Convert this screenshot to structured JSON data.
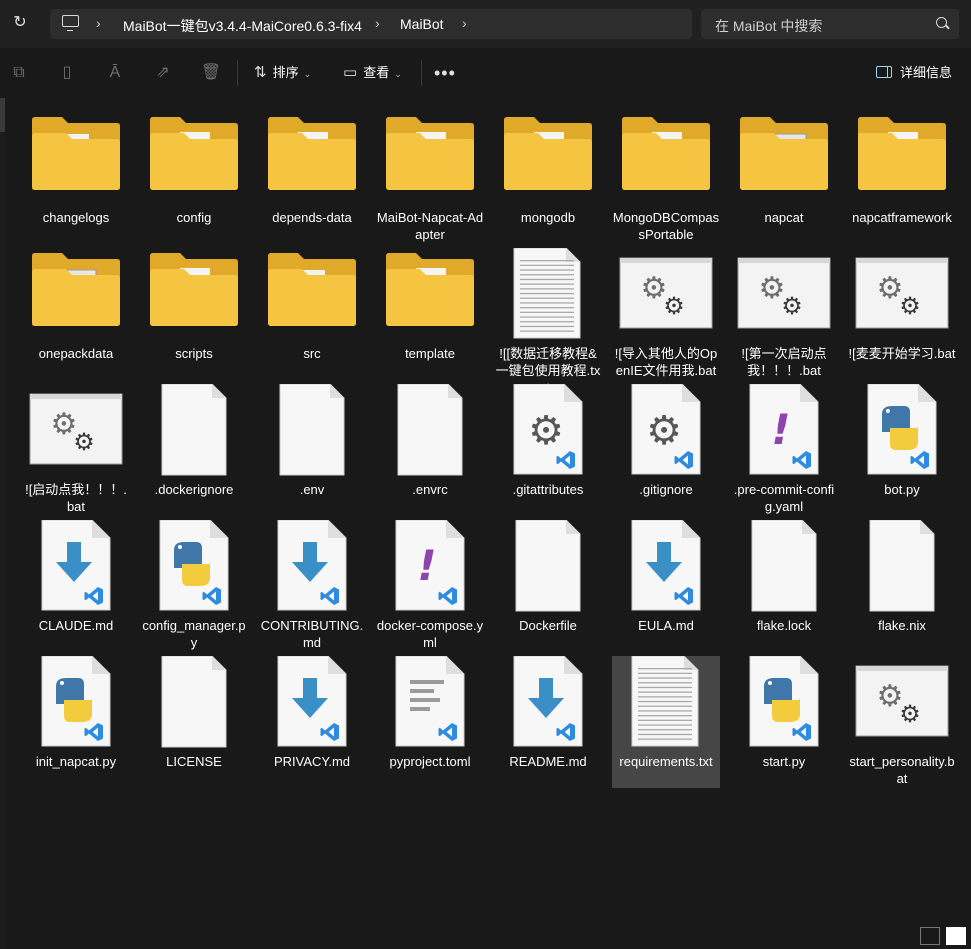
{
  "breadcrumb": [
    "MaiBot一键包v3.4.4-MaiCore0.6.3-fix4",
    "MaiBot"
  ],
  "search": {
    "placeholder": "在 MaiBot 中搜索"
  },
  "toolbar": {
    "sort_label": "排序",
    "view_label": "查看",
    "details_label": "详细信息"
  },
  "colors": {
    "folder": "#f5c542",
    "folder_back": "#e0a92a",
    "accent": "#3d8ad6",
    "python_blue": "#3f77a8",
    "python_yellow": "#f2cc3c",
    "markdown": "#3a8fc7",
    "yaml": "#8e44ad",
    "gear": "#5b5b5b"
  },
  "items": [
    {
      "name": "changelogs",
      "type": "folder",
      "glyph": "vscode"
    },
    {
      "name": "config",
      "type": "folder",
      "glyph": "doc"
    },
    {
      "name": "depends-data",
      "type": "folder",
      "glyph": "json"
    },
    {
      "name": "MaiBot-Napcat-Adapter",
      "type": "folder",
      "glyph": "gear"
    },
    {
      "name": "mongodb",
      "type": "folder",
      "glyph": "doc"
    },
    {
      "name": "MongoDBCompassPortable",
      "type": "folder",
      "glyph": "plain"
    },
    {
      "name": "napcat",
      "type": "folder",
      "glyph": "gearwin"
    },
    {
      "name": "napcatframework",
      "type": "folder",
      "glyph": "gear"
    },
    {
      "name": "onepackdata",
      "type": "folder",
      "glyph": "winapp"
    },
    {
      "name": "scripts",
      "type": "folder",
      "glyph": "python"
    },
    {
      "name": "src",
      "type": "folder",
      "glyph": "vscode"
    },
    {
      "name": "template",
      "type": "folder",
      "glyph": "doc"
    },
    {
      "name": "![[数据迁移教程&一键包使用教程.txt",
      "type": "txt"
    },
    {
      "name": "![导入其他人的OpenIE文件用我.bat",
      "type": "bat"
    },
    {
      "name": "![第一次启动点我！！！.bat",
      "type": "bat"
    },
    {
      "name": "![麦麦开始学习.bat",
      "type": "bat"
    },
    {
      "name": "![启动点我！！！.bat",
      "type": "bat"
    },
    {
      "name": ".dockerignore",
      "type": "blank"
    },
    {
      "name": ".env",
      "type": "blank"
    },
    {
      "name": ".envrc",
      "type": "blank"
    },
    {
      "name": ".gitattributes",
      "type": "gitfile"
    },
    {
      "name": ".gitignore",
      "type": "gitfile"
    },
    {
      "name": ".pre-commit-config.yaml",
      "type": "yaml"
    },
    {
      "name": "bot.py",
      "type": "py"
    },
    {
      "name": "CLAUDE.md",
      "type": "md"
    },
    {
      "name": "config_manager.py",
      "type": "py"
    },
    {
      "name": "CONTRIBUTING.md",
      "type": "md"
    },
    {
      "name": "docker-compose.yml",
      "type": "yaml"
    },
    {
      "name": "Dockerfile",
      "type": "blank"
    },
    {
      "name": "EULA.md",
      "type": "md"
    },
    {
      "name": "flake.lock",
      "type": "blank"
    },
    {
      "name": "flake.nix",
      "type": "blank"
    },
    {
      "name": "init_napcat.py",
      "type": "py"
    },
    {
      "name": "LICENSE",
      "type": "blank"
    },
    {
      "name": "PRIVACY.md",
      "type": "md"
    },
    {
      "name": "pyproject.toml",
      "type": "toml"
    },
    {
      "name": "README.md",
      "type": "md"
    },
    {
      "name": "requirements.txt",
      "type": "txt",
      "selected": true
    },
    {
      "name": "start.py",
      "type": "py"
    },
    {
      "name": "start_personality.bat",
      "type": "bat"
    }
  ]
}
